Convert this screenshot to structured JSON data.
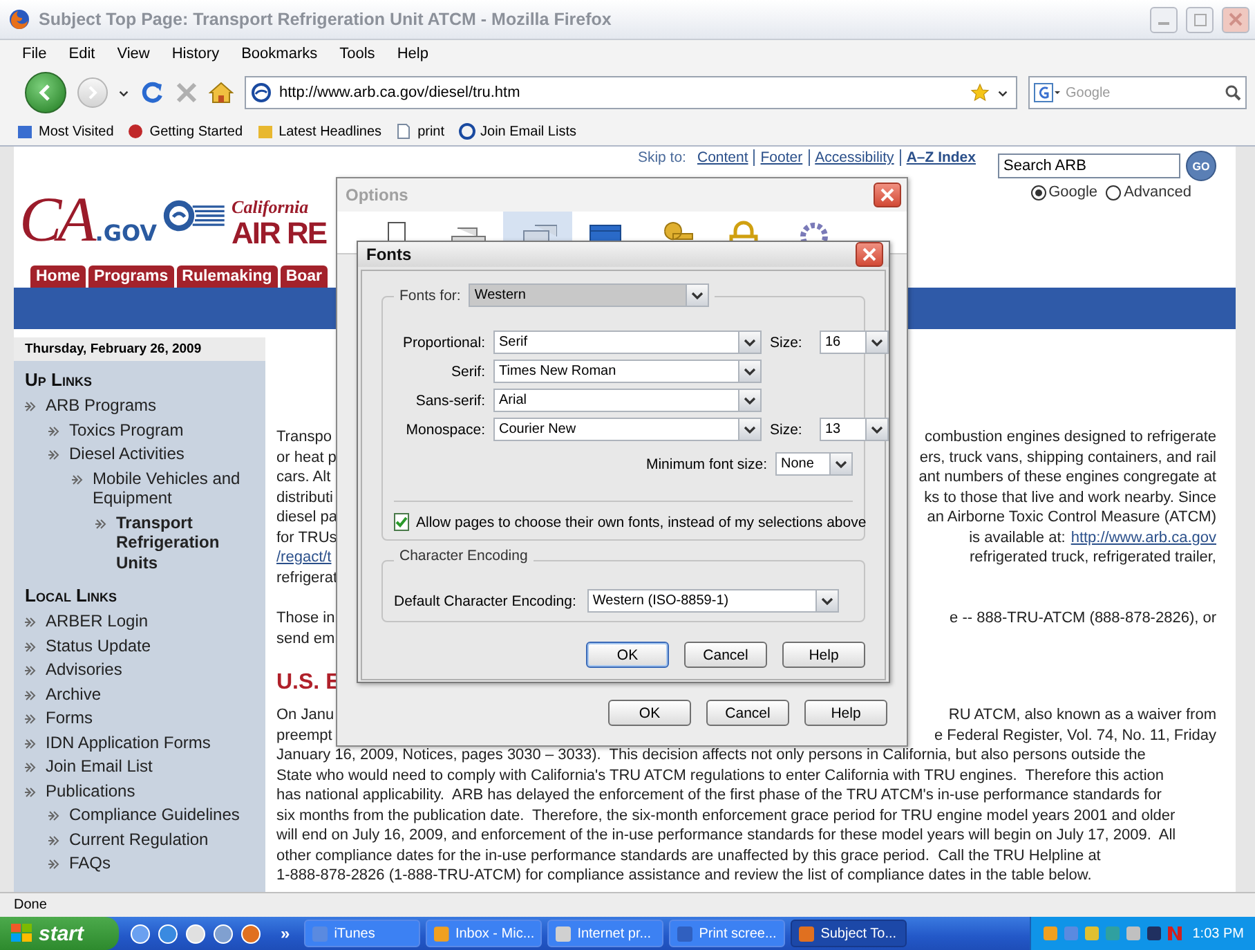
{
  "window": {
    "title": "Subject Top Page: Transport Refrigeration Unit ATCM - Mozilla Firefox"
  },
  "menu": [
    "File",
    "Edit",
    "View",
    "History",
    "Bookmarks",
    "Tools",
    "Help"
  ],
  "navigation": {
    "url": "http://www.arb.ca.gov/diesel/tru.htm",
    "search_placeholder": "Google"
  },
  "bookmarks": [
    {
      "kind": "list",
      "label": "Most Visited"
    },
    {
      "kind": "start",
      "label": "Getting Started"
    },
    {
      "kind": "feed",
      "label": "Latest Headlines"
    },
    {
      "kind": "page",
      "label": "print"
    },
    {
      "kind": "site",
      "label": "Join Email Lists"
    }
  ],
  "page": {
    "logo": {
      "ca": "CA",
      "gov": ".GOV",
      "agency_top": "California",
      "agency_main": "AIR RE"
    },
    "nav_tabs": [
      "Home",
      "Programs",
      "Rulemaking",
      "Boar"
    ],
    "skip_links": {
      "label": "Skip to:",
      "links": [
        "Content",
        "Footer",
        "Accessibility",
        "A–Z Index"
      ]
    },
    "search": {
      "value": "Search ARB",
      "button": "GO",
      "options": [
        {
          "label": "Google",
          "selected": true
        },
        {
          "label": "Advanced",
          "selected": false
        }
      ]
    },
    "date": "Thursday, February 26, 2009",
    "up_links": {
      "heading": "Up Links",
      "items": [
        {
          "label": "ARB Programs",
          "selected": false,
          "children": [
            {
              "label": "Toxics Program",
              "selected": false
            },
            {
              "label": "Diesel Activities",
              "selected": false,
              "children": [
                {
                  "label": "Mobile Vehicles and Equipment",
                  "selected": false,
                  "children": [
                    {
                      "label": "Transport Refrigeration Units",
                      "selected": true
                    }
                  ]
                }
              ]
            }
          ]
        }
      ]
    },
    "local_links": {
      "heading": "Local Links",
      "items": [
        {
          "label": "ARBER Login",
          "selected": false
        },
        {
          "label": "Status Update",
          "selected": false
        },
        {
          "label": "Advisories",
          "selected": false
        },
        {
          "label": "Archive",
          "selected": false
        },
        {
          "label": "Forms",
          "selected": false
        },
        {
          "label": "IDN Application Forms",
          "selected": false
        },
        {
          "label": "Join Email List",
          "selected": false
        },
        {
          "label": "Publications",
          "selected": false,
          "children": [
            {
              "label": "Compliance Guidelines",
              "selected": false
            },
            {
              "label": "Current Regulation",
              "selected": false
            },
            {
              "label": "FAQs",
              "selected": false
            }
          ]
        }
      ]
    },
    "content": [
      {
        "kind": "paragraph",
        "lines": [
          {
            "left": "Transpo",
            "right": "combustion engines designed to refrigerate"
          },
          {
            "left": "or heat p",
            "right": "ers, truck vans, shipping containers, and rail"
          },
          {
            "left": "cars. Alt",
            "right": "ant numbers of these engines congregate at"
          },
          {
            "left": "distributi",
            "right": "ks to those that live and work nearby. Since"
          },
          {
            "left": "diesel pa",
            "right": "an Airborne Toxic Control Measure (ATCM)"
          },
          {
            "left": "for TRUs",
            "right": "is available at:",
            "right_link": "http://www.arb.ca.gov"
          },
          {
            "left_link": "/regact/t",
            "right": "refrigerated truck, refrigerated trailer,"
          },
          {
            "left": "refrigerat"
          }
        ]
      },
      {
        "kind": "paragraph",
        "lines": [
          {
            "left": "Those in",
            "right": "e -- 888-TRU-ATCM (888-878-2826), or"
          },
          {
            "left": "send em"
          }
        ]
      },
      {
        "kind": "heading",
        "lines": [
          {
            "left": "U.S. E"
          }
        ]
      },
      {
        "kind": "paragraph",
        "lines": [
          {
            "left": "On Janu",
            "right": "RU ATCM, also known as a waiver from"
          },
          {
            "left": "preempt",
            "right": "e Federal Register, Vol. 74, No. 11, Friday"
          },
          {
            "text": "January 16, 2009, Notices, pages 3030 – 3033).  This decision affects not only persons in California, but also persons outside the"
          },
          {
            "text": "State who would need to comply with California's TRU ATCM regulations to enter California with TRU engines.  Therefore this action"
          },
          {
            "text": "has national applicability.  ARB has delayed the enforcement of the first phase of the TRU ATCM's in-use performance standards for"
          },
          {
            "text": "six months from the publication date.  Therefore, the six-month enforcement grace period for TRU engine model years 2001 and older"
          },
          {
            "text": "will end on July 16, 2009, and enforcement of the in-use performance standards for these model years will begin on July 17, 2009.  All"
          },
          {
            "text": "other compliance dates for the in-use performance standards are unaffected by this grace period.  Call the TRU Helpline at"
          },
          {
            "text": "1-888-878-2826 (1-888-TRU-ATCM) for compliance assistance and review the list of compliance dates in the table below."
          }
        ]
      }
    ]
  },
  "options_dialog": {
    "title": "Options",
    "panes": [
      {
        "selected": false
      },
      {
        "selected": false
      },
      {
        "selected": true
      },
      {
        "selected": false
      },
      {
        "selected": false
      },
      {
        "selected": false
      },
      {
        "selected": false
      }
    ],
    "buttons": [
      "OK",
      "Cancel",
      "Help"
    ]
  },
  "fonts_dialog": {
    "title": "Fonts",
    "fonts_for": {
      "label": "Fonts for:",
      "value": "Western"
    },
    "rows": [
      {
        "label": "Proportional:",
        "value": "Serif",
        "size_label": "Size:",
        "size": "16"
      },
      {
        "label": "Serif:",
        "value": "Times New Roman"
      },
      {
        "label": "Sans-serif:",
        "value": "Arial"
      },
      {
        "label": "Monospace:",
        "value": "Courier New",
        "size_label": "Size:",
        "size": "13"
      }
    ],
    "minimum": {
      "label": "Minimum font size:",
      "value": "None"
    },
    "allow": {
      "label": "Allow pages to choose their own fonts, instead of my selections above",
      "checked": true
    },
    "encoding": {
      "legend": "Character Encoding",
      "label": "Default Character Encoding:",
      "value": "Western (ISO-8859-1)"
    },
    "buttons": [
      {
        "label": "OK",
        "default": true
      },
      {
        "label": "Cancel",
        "default": false
      },
      {
        "label": "Help",
        "default": false
      }
    ]
  },
  "status": "Done",
  "taskbar": {
    "start": "start",
    "more": "»",
    "tasks": [
      {
        "label": "iTunes",
        "selected": false
      },
      {
        "label": "Inbox - Mic...",
        "selected": false
      },
      {
        "label": "Internet pr...",
        "selected": false
      },
      {
        "label": "Print scree...",
        "selected": false
      },
      {
        "label": "Subject To...",
        "selected": true
      }
    ],
    "clock": "1:03 PM"
  }
}
